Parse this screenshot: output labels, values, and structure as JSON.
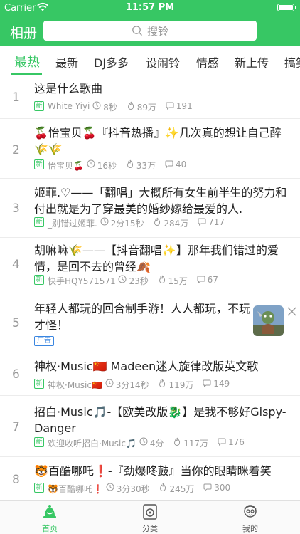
{
  "status_bar": {
    "carrier": "Carrier",
    "time": "11:57 PM"
  },
  "nav": {
    "title": "相册",
    "search_placeholder": "搜铃"
  },
  "tabs": [
    "最热",
    "最新",
    "DJ多多",
    "设闹铃",
    "情感",
    "新上传",
    "搞笑"
  ],
  "songs": [
    {
      "index": "1",
      "title": "这是什么歌曲",
      "new_badge": "新",
      "author": "White Yiyi",
      "duration": "8秒",
      "plays": "89万",
      "comments": "191"
    },
    {
      "index": "2",
      "title": "🍒怡宝贝🍒『抖音热播』✨几次真的想让自己醉🌾🌾",
      "new_badge": "新",
      "author": "怡宝贝🍒",
      "duration": "16秒",
      "plays": "33万",
      "comments": "40"
    },
    {
      "index": "3",
      "title": "姬菲.♡——「翻唱」大概所有女生前半生的努力和付出就是为了穿最美的婚纱嫁给最爱的人.",
      "new_badge": "新",
      "author": "_别错过姬菲.",
      "duration": "2分15秒",
      "plays": "284万",
      "comments": "717"
    },
    {
      "index": "4",
      "title": "胡嘛嘛🌾——【抖音翻唱✨】那年我们错过的爱情，是回不去的曾经🍂",
      "new_badge": "新",
      "author": "快手HQY571571",
      "duration": "23秒",
      "plays": "15万",
      "comments": "67"
    },
    {
      "index": "5",
      "title": "年轻人都玩的回合制手游！人人都玩，不玩才怪！",
      "ad_badge": "广告"
    },
    {
      "index": "6",
      "title": "神权·Music🇨🇳 Madeen迷人旋律改版英文歌",
      "new_badge": "新",
      "author": "神权·Music🇨🇳",
      "duration": "3分14秒",
      "plays": "119万",
      "comments": "149"
    },
    {
      "index": "7",
      "title": "招白·Music🎵-【欧美改版🐉】是我不够好Gispy-Danger",
      "new_badge": "新",
      "author": "欢迎收听招白·Music🎵",
      "duration": "4分",
      "plays": "117万",
      "comments": "176"
    },
    {
      "index": "8",
      "title": "🐯百酷哪吒❗-『劲爆咚鼓』当你的眼睛眯着笑",
      "new_badge": "新",
      "author": "🐯百酷哪吒❗",
      "duration": "3分30秒",
      "plays": "245万",
      "comments": "300"
    }
  ],
  "tabbar": {
    "home": "首页",
    "category": "分类",
    "mine": "我的"
  },
  "colors": {
    "accent": "#37c764",
    "ad": "#3a86e0",
    "muted": "#9a9a9a"
  }
}
